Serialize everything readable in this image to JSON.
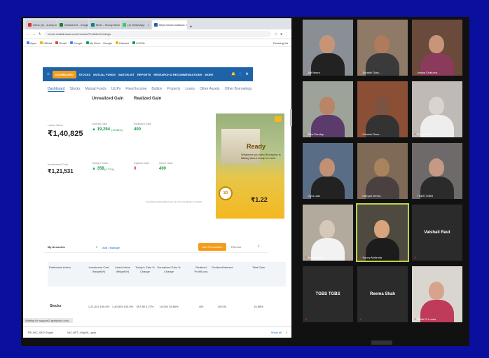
{
  "browser": {
    "tabs": [
      {
        "label": "Inbox (3) - sunny.m",
        "color": "#d93025"
      },
      {
        "label": "Worksheet - Google",
        "color": "#188038"
      },
      {
        "label": "Meet - Sunny Munish",
        "color": "#00897b"
      },
      {
        "label": "(1) WhatsApp",
        "color": "#25d366"
      },
      {
        "label": "https://www.motilaos",
        "color": "#1e63a8",
        "active": true
      }
    ],
    "url": "invest.motilaloswal.com/Investor/Portfolio/Holdings",
    "bookmarks": [
      "Apps",
      "Official",
      "Gmail",
      "Google",
      "My Drive - Google",
      "Classes",
      "LOGIN"
    ],
    "reading_list": "Reading list"
  },
  "site": {
    "nav_items": [
      "DASHBOARD",
      "STOCKS",
      "MUTUAL FUNDS",
      "WATCHLIST",
      "REPORTS",
      "RESEARCH & RECOMMENDATIONS",
      "MORE"
    ],
    "subtabs": [
      "Dashboard",
      "Stocks",
      "Mutual Funds",
      "ULIPs",
      "Fixed Income",
      "Bullion",
      "Property",
      "Loans",
      "Other Assets",
      "Other Borrowings"
    ],
    "unrealized_title": "Unrealized Gain",
    "realized_title": "Realized Gain",
    "latest_value_label": "Latest Value",
    "latest_value": "₹1,40,825",
    "investment_cost_label": "Investment Cost",
    "investment_cost": "₹1,21,531",
    "overall_gain_label": "Overall Gain",
    "overall_gain": "▲ 19,294",
    "overall_gain_pct": "(15.88%)",
    "todays_gain_label": "Today's Gain",
    "todays_gain": "▲ 358",
    "todays_gain_pct": "(0.27%)",
    "realized_gain_label": "Realized Gain",
    "realized_gain": "400",
    "capital_gain_label": "Capital Gain",
    "capital_gain": "0",
    "other_gain_label": "Other Gain",
    "other_gain": "400",
    "note": "Unrealised and Realised gain for current holdings in portfolio",
    "ad": {
      "headline": "Ready",
      "text": "Whatever you need Everyone is talking about ready to move",
      "price": "₹1.22",
      "badge": "30"
    },
    "my_accounts": "My Accounts",
    "add_manage": "Add / Manage",
    "add_transaction": "Add Transaction",
    "refresh": "Refresh",
    "table_headers": [
      "Particulars Action",
      "Investment Cost Weight(%)",
      "Latest Value Weight(%)",
      "Today's Gain % Change",
      "Unrealized Gain % Change",
      "Realized Profit/Loss",
      "Dividend/Interest",
      "Total Gain"
    ],
    "row": {
      "name": "Stocks",
      "cells": [
        "1,21,531 100.0%",
        "1,40,825 100.0%",
        "357.85 0.27%",
        "19,294 15.88%",
        "400",
        "400.00",
        "15.88%"
      ]
    },
    "status": "Waiting for support2.grafpfolio.com...",
    "downloads": [
      "TRI-NIC_06Z+Tugok",
      "NIC-NFT_May26_.gzip"
    ],
    "show_all": "Show all"
  },
  "meet": {
    "participants": [
      {
        "name": "Ajit Neary",
        "skin": "#c89478",
        "bg": "#8a8f96",
        "shirt": "#222"
      },
      {
        "name": "Surabhi Gaw...",
        "skin": "#b07a5c",
        "bg": "#8e7a66",
        "shirt": "#3a3a3a"
      },
      {
        "name": "Aratya Chaturve...",
        "skin": "#c8957a",
        "bg": "#6a4a3a",
        "shirt": "#8a3a5a"
      },
      {
        "name": "Riva Pandey",
        "skin": "#b98467",
        "bg": "#9ea39a",
        "shirt": "#5b3b6b"
      },
      {
        "name": "Ganesh Dam...",
        "skin": "#7c5240",
        "bg": "#8a4f34",
        "shirt": "#333"
      },
      {
        "name": "Prashant Ch...",
        "skin": "#d9d4cf",
        "bg": "#bfbab5",
        "shirt": "#eee"
      },
      {
        "name": "Oyes Jain",
        "skin": "#c29073",
        "bg": "#5a6d86",
        "shirt": "#222"
      },
      {
        "name": "Hiteyati Verma",
        "skin": "#a9825e",
        "bg": "#7e6a56",
        "shirt": "#4a4040"
      },
      {
        "name": "TGBS TGBS",
        "skin": "#c49a84",
        "bg": "#6f6a6a",
        "shirt": "#2b2b2b"
      },
      {
        "name": "Megha Sarkar",
        "skin": "#d6c8b8",
        "bg": "#b3aa9e",
        "shirt": "#f2f2f2"
      },
      {
        "name": "Sunny Motirolar",
        "skin": "#d7a47c",
        "bg": "#4f4a40",
        "shirt": "#1c1c1c",
        "selected": true
      },
      {
        "name": "Vaishali Raut",
        "text_only": true
      },
      {
        "name": "TGBS TGBS",
        "text_only": true
      },
      {
        "name": "Reema Shah",
        "text_only": true
      },
      {
        "name": "Bhilal Di Lunha",
        "skin": "#d7a38e",
        "bg": "#d9d6cf",
        "shirt": "#c03a5a"
      }
    ]
  }
}
